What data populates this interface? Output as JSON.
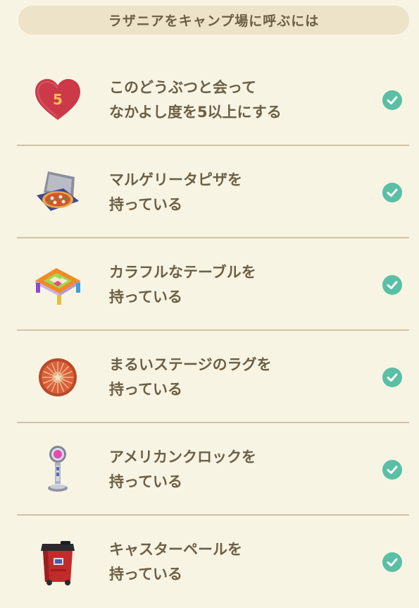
{
  "header": {
    "title": "ラザニアをキャンプ場に呼ぶには"
  },
  "heart_badge_number": "5",
  "conditions": [
    {
      "icon": "heart-5-icon",
      "line1": "このどうぶつと会って",
      "line2": "なかよし度を5以上にする",
      "done": true
    },
    {
      "icon": "margherita-pizza-icon",
      "line1": "マルゲリータピザを",
      "line2": "持っている",
      "done": true
    },
    {
      "icon": "colorful-table-icon",
      "line1": "カラフルなテーブルを",
      "line2": "持っている",
      "done": true
    },
    {
      "icon": "round-stage-rug-icon",
      "line1": "まるいステージのラグを",
      "line2": "持っている",
      "done": true
    },
    {
      "icon": "american-clock-icon",
      "line1": "アメリカンクロックを",
      "line2": "持っている",
      "done": true
    },
    {
      "icon": "caster-pail-icon",
      "line1": "キャスターペールを",
      "line2": "持っている",
      "done": true
    }
  ],
  "colors": {
    "background": "#f8f4e3",
    "header_bg": "#ece3c9",
    "text": "#6b5f46",
    "check": "#59bfa5",
    "divider": "#cfc4a5"
  }
}
